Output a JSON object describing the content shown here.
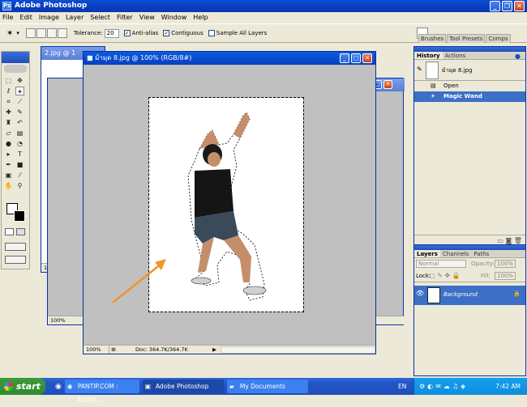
{
  "app": {
    "title": "Adobe Photoshop",
    "icon_text": "Ps"
  },
  "menu": [
    "File",
    "Edit",
    "Image",
    "Layer",
    "Select",
    "Filter",
    "View",
    "Window",
    "Help"
  ],
  "options": {
    "tolerance_label": "Tolerance:",
    "tolerance_value": "20",
    "anti_alias": "Anti-alias",
    "contiguous": "Contiguous",
    "sample_all": "Sample All Layers",
    "wells": [
      "Brushes",
      "Tool Presets",
      "Comps"
    ]
  },
  "docs": {
    "back_title": "2.jpg @ 1",
    "back_zoom": "100%",
    "mid_zoom": "100%",
    "front_title": "ม้ามุด 8.jpg @ 100% (RGB/8#)",
    "front_zoom": "100%",
    "front_doc_size": "Doc: 364.7K/364.7K"
  },
  "history_panel": {
    "tabs": [
      "History",
      "Actions"
    ],
    "snapshot": "ม้ามุด 8.jpg",
    "items": [
      "Open",
      "Magic Wand"
    ]
  },
  "layers_panel": {
    "tabs": [
      "Layers",
      "Channels",
      "Paths"
    ],
    "blend_mode": "Normal",
    "opacity_label": "Opacity:",
    "opacity": "100%",
    "lock_label": "Lock:",
    "fill_label": "Fill:",
    "fill": "100%",
    "layer_name": "Background"
  },
  "taskbar": {
    "start": "start",
    "tasks": [
      "PANTIP.COM : R1074...",
      "Adobe Photoshop",
      "My Documents"
    ],
    "lang": "EN",
    "time": "7:42 AM"
  },
  "colors": {
    "xp_blue": "#0a4fd6",
    "selection_blue": "#3d6fc6",
    "arrow_orange": "#f0962a"
  }
}
